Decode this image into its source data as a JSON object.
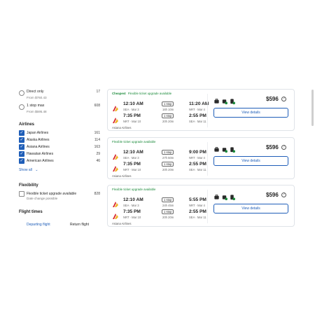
{
  "filters": {
    "stops": [
      {
        "label": "Direct only",
        "sub": "From $760.43",
        "count": "17"
      },
      {
        "label": "1 stop max",
        "sub": "From $595.48",
        "count": "608"
      }
    ],
    "airlines_title": "Airlines",
    "airlines": [
      {
        "label": "Japan Airlines",
        "count": "161",
        "checked": true
      },
      {
        "label": "Alaska Airlines",
        "count": "114",
        "checked": true
      },
      {
        "label": "Asiana Airlines",
        "count": "163",
        "checked": true
      },
      {
        "label": "Hawaiian Airlines",
        "count": "29",
        "checked": true
      },
      {
        "label": "American Airlines",
        "count": "46",
        "checked": true
      }
    ],
    "show_all": "Show all",
    "flexibility_title": "Flexibility",
    "flexibility": {
      "label": "Flexible ticket upgrade available",
      "sub": "Date change possible",
      "count": "828"
    },
    "flight_times_title": "Flight times",
    "tabs": {
      "departing": "Departing flight",
      "return": "Return flight"
    }
  },
  "results": [
    {
      "cheapest": "Cheapest",
      "flex_label": "Flexible ticket upgrade available",
      "outbound": {
        "dep_time": "12:10 AM",
        "dep_sub": "SEA · Mar 3",
        "stops": "1 stop",
        "duration": "16h 10m",
        "arr_time": "11:20 AM",
        "arr_sub": "NRT · Mar 4"
      },
      "inbound": {
        "dep_time": "7:35 PM",
        "dep_sub": "NRT · Mar 10",
        "stops": "1 stop",
        "duration": "20h 20m",
        "arr_time": "2:55 PM",
        "arr_sub": "SEA · Mar 11"
      },
      "carrier": "Asiana Airlines",
      "price": "$596",
      "button": "View details"
    },
    {
      "cheapest": "",
      "flex_label": "Flexible ticket upgrade available",
      "outbound": {
        "dep_time": "12:10 AM",
        "dep_sub": "SEA · Mar 3",
        "stops": "1 stop",
        "duration": "27h 50m",
        "arr_time": "9:00 PM",
        "arr_sub": "NRT · Mar 4"
      },
      "inbound": {
        "dep_time": "7:35 PM",
        "dep_sub": "NRT · Mar 10",
        "stops": "1 stop",
        "duration": "20h 20m",
        "arr_time": "2:55 PM",
        "arr_sub": "SEA · Mar 11"
      },
      "carrier": "Asiana Airlines",
      "price": "$596",
      "button": "View details"
    },
    {
      "cheapest": "",
      "flex_label": "Flexible ticket upgrade available",
      "outbound": {
        "dep_time": "12:10 AM",
        "dep_sub": "SEA · Mar 3",
        "stops": "1 stop",
        "duration": "24h 45m",
        "arr_time": "5:55 PM",
        "arr_sub": "NRT · Mar 4"
      },
      "inbound": {
        "dep_time": "7:35 PM",
        "dep_sub": "NRT · Mar 10",
        "stops": "1 stop",
        "duration": "20h 20m",
        "arr_time": "2:55 PM",
        "arr_sub": "SEA · Mar 11"
      },
      "carrier": "Asiana Airlines",
      "price": "$596",
      "button": "View details"
    }
  ],
  "colors": {
    "accent": "#1f5eb8",
    "green": "#1a8a3a",
    "logo_red": "#d7262e",
    "logo_yellow": "#f0b323"
  },
  "icons": {
    "amenities": [
      "luggage-icon",
      "carry-on-icon",
      "checked-bag-icon"
    ],
    "info": "info-icon",
    "airline_logo": "asiana-logo-icon"
  }
}
